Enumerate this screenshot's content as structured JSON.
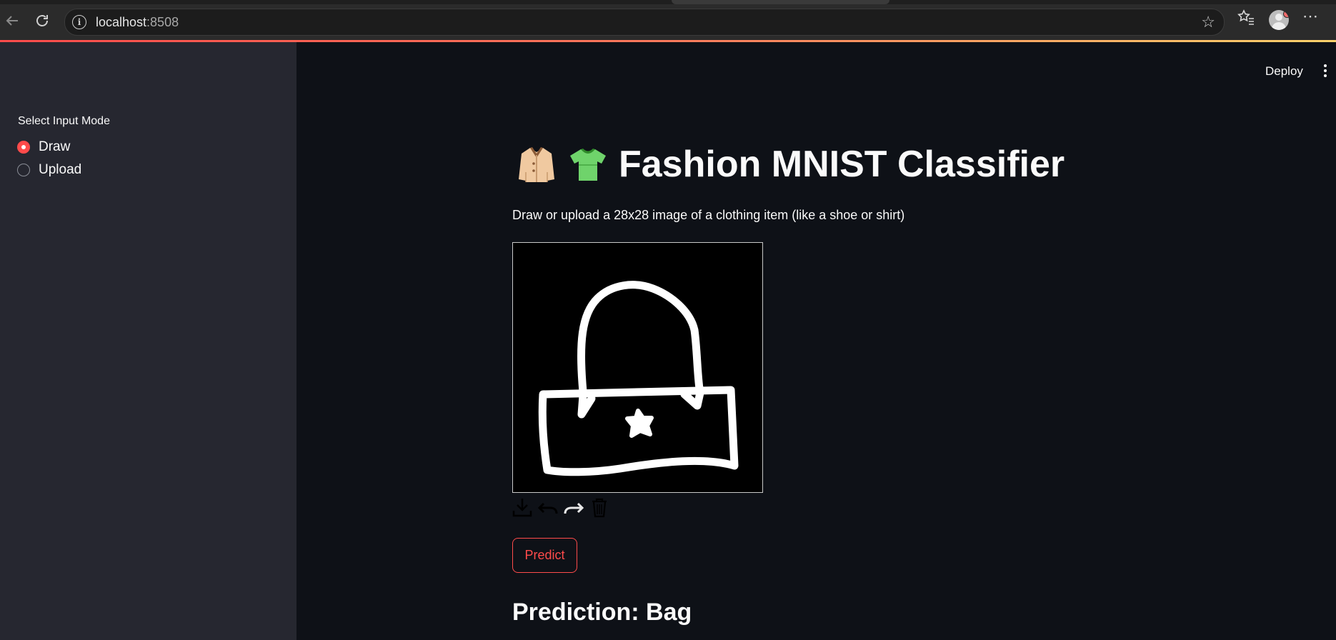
{
  "browser": {
    "url_host": "localhost",
    "url_port": ":8508"
  },
  "sidebar": {
    "mode_label": "Select Input Mode",
    "options": [
      {
        "label": "Draw",
        "selected": true
      },
      {
        "label": "Upload",
        "selected": false
      }
    ]
  },
  "header": {
    "deploy_label": "Deploy"
  },
  "main": {
    "title": "Fashion MNIST Classifier",
    "title_icons": [
      "coat-icon",
      "tshirt-icon"
    ],
    "subtitle": "Draw or upload a 28x28 image of a clothing item (like a shoe or shirt)",
    "canvas_tools": [
      "download-icon",
      "undo-icon",
      "redo-icon",
      "trash-icon"
    ],
    "predict_label": "Predict",
    "prediction_text": "Prediction: Bag"
  },
  "colors": {
    "accent": "#ff4b4b",
    "background": "#0e1117",
    "sidebar": "#262730"
  }
}
